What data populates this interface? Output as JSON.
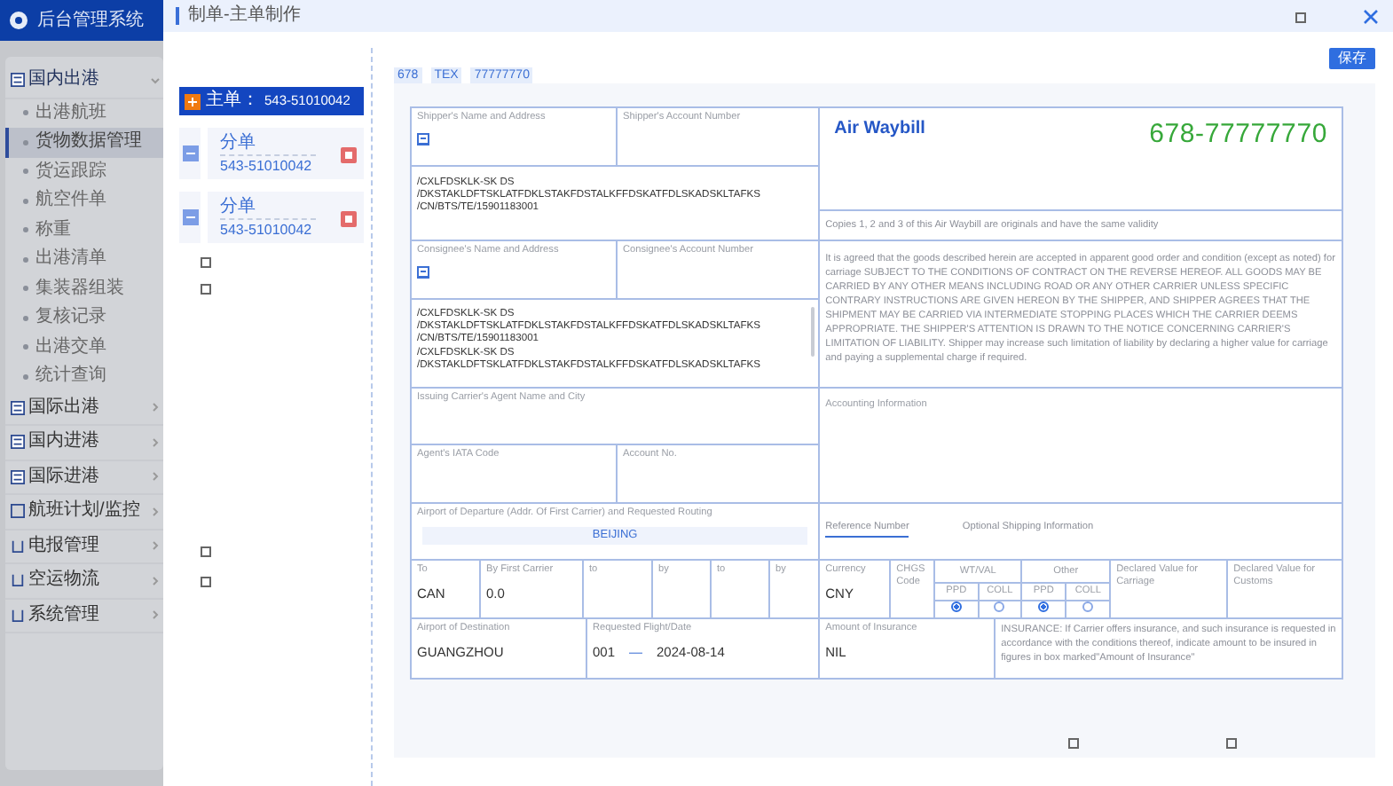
{
  "app": {
    "title": "后台管理系统"
  },
  "sidebar": {
    "items": [
      {
        "label": "国内出港",
        "expanded": true,
        "children": [
          {
            "label": "出港航班",
            "selected": false
          },
          {
            "label": "货物数据管理",
            "selected": true
          },
          {
            "label": "货运跟踪",
            "selected": false
          },
          {
            "label": "航空件单",
            "selected": false
          },
          {
            "label": "称重",
            "selected": false
          },
          {
            "label": "出港清单",
            "selected": false
          },
          {
            "label": "集装器组装",
            "selected": false
          },
          {
            "label": "复核记录",
            "selected": false
          },
          {
            "label": "出港交单",
            "selected": false
          },
          {
            "label": "统计查询",
            "selected": false
          }
        ]
      },
      {
        "label": "国际出港",
        "expanded": false
      },
      {
        "label": "国内进港",
        "expanded": false
      },
      {
        "label": "国际进港",
        "expanded": false
      },
      {
        "label": "航班计划/监控",
        "expanded": false
      },
      {
        "label": "电报管理",
        "expanded": false
      },
      {
        "label": "空运物流",
        "expanded": false
      },
      {
        "label": "系统管理",
        "expanded": false
      }
    ]
  },
  "dialog": {
    "title": "制单-主单制作"
  },
  "master": {
    "label": "主单：",
    "number": "543-51010042"
  },
  "house_bills": [
    {
      "label": "分单",
      "number": "543-51010042"
    },
    {
      "label": "分单",
      "number": "543-51010042"
    }
  ],
  "tags": [
    "678",
    "TEX",
    "77777770"
  ],
  "save_button": "保存",
  "air_waybill": {
    "shipper_label": "Shipper's Name and Address",
    "shipper_account_label": "Shipper's Account Number",
    "shipper_lines": [
      "/CXLFDSKLK-SK DS",
      "/DKSTAKLDFTSKLATFDKLSTAKFDSTALKFFDSKATFDLSKADSKLTAFKS",
      "/CN/BTS/TE/15901183001"
    ],
    "consignee_label": "Consignee's Name and Address",
    "consignee_account_label": "Consignee's Account Number",
    "consignee_lines": [
      "/CXLFDSKLK-SK DS",
      "/DKSTAKLDFTSKLATFDKLSTAKFDSTALKFFDSKATFDLSKADSKLTAFKS",
      "/CN/BTS/TE/15901183001",
      "/CXLFDSKLK-SK DS",
      "/DKSTAKLDFTSKLATFDKLSTAKFDSTALKFFDSKATFDLSKADSKLTAFKS"
    ],
    "agent_label": "Issuing Carrier's Agent Name and City",
    "iata_label": "Agent's IATA Code",
    "account_no_label": "Account No.",
    "departure_label": "Airport of Departure (Addr. Of First Carrier) and Requested Routing",
    "departure_value": "BEIJING",
    "routing": [
      {
        "label": "To",
        "value": "CAN"
      },
      {
        "label": "By First Carrier",
        "value": "0.0"
      },
      {
        "label": "to"
      },
      {
        "label": "by"
      },
      {
        "label": "to"
      },
      {
        "label": "by"
      }
    ],
    "destination_label": "Airport of Destination",
    "destination_value": "GUANGZHOU",
    "flight_label": "Requested Flight/Date",
    "flight_value": "001",
    "flight_dash": "—",
    "flight_date": "2024-08-14",
    "title": "Air Waybill",
    "awb_number": "678-77777770",
    "copies_note": "Copies 1, 2 and 3 of this Air Waybill are originals and have the same validity",
    "conditions": "It is agreed that the goods described herein are accepted in apparent good order and condition (except as noted) for carriage SUBJECT TO THE CONDITIONS OF CONTRACT ON THE REVERSE HEREOF. ALL GOODS MAY BE CARRIED BY ANY OTHER MEANS INCLUDING ROAD OR ANY OTHER CARRIER UNLESS SPECIFIC CONTRARY INSTRUCTIONS ARE GIVEN HEREON BY THE SHIPPER, AND SHIPPER AGREES THAT THE SHIPMENT MAY BE CARRIED VIA INTERMEDIATE STOPPING PLACES WHICH THE CARRIER DEEMS APPROPRIATE. THE SHIPPER'S ATTENTION IS DRAWN TO THE NOTICE CONCERNING CARRIER'S LIMITATION OF LIABILITY. Shipper may increase such limitation of liability by declaring a higher value for carriage and paying a supplemental charge if required.",
    "accounting_label": "Accounting Information",
    "info_tabs": [
      {
        "label": "Reference Number",
        "selected": true
      },
      {
        "label": "Optional Shipping Information",
        "selected": false
      }
    ],
    "currency_label": "Currency",
    "currency_value": "CNY",
    "chgs_label": "CHGS Code",
    "charge_groups": [
      {
        "label": "WT/VAL",
        "options": [
          {
            "label": "PPD",
            "selected": true
          },
          {
            "label": "COLL",
            "selected": false
          }
        ]
      },
      {
        "label": "Other",
        "options": [
          {
            "label": "PPD",
            "selected": true
          },
          {
            "label": "COLL",
            "selected": false
          }
        ]
      }
    ],
    "carriage_label": "Declared Value for Carriage",
    "customs_label": "Declared Value for Customs",
    "insurance_label": "Amount of Insurance",
    "insurance_value": "NIL",
    "insurance_note": "INSURANCE: If Carrier offers insurance, and such insurance is requested in accordance with the conditions thereof, indicate amount to be insured in figures in box marked\"Amount of Insurance\""
  }
}
